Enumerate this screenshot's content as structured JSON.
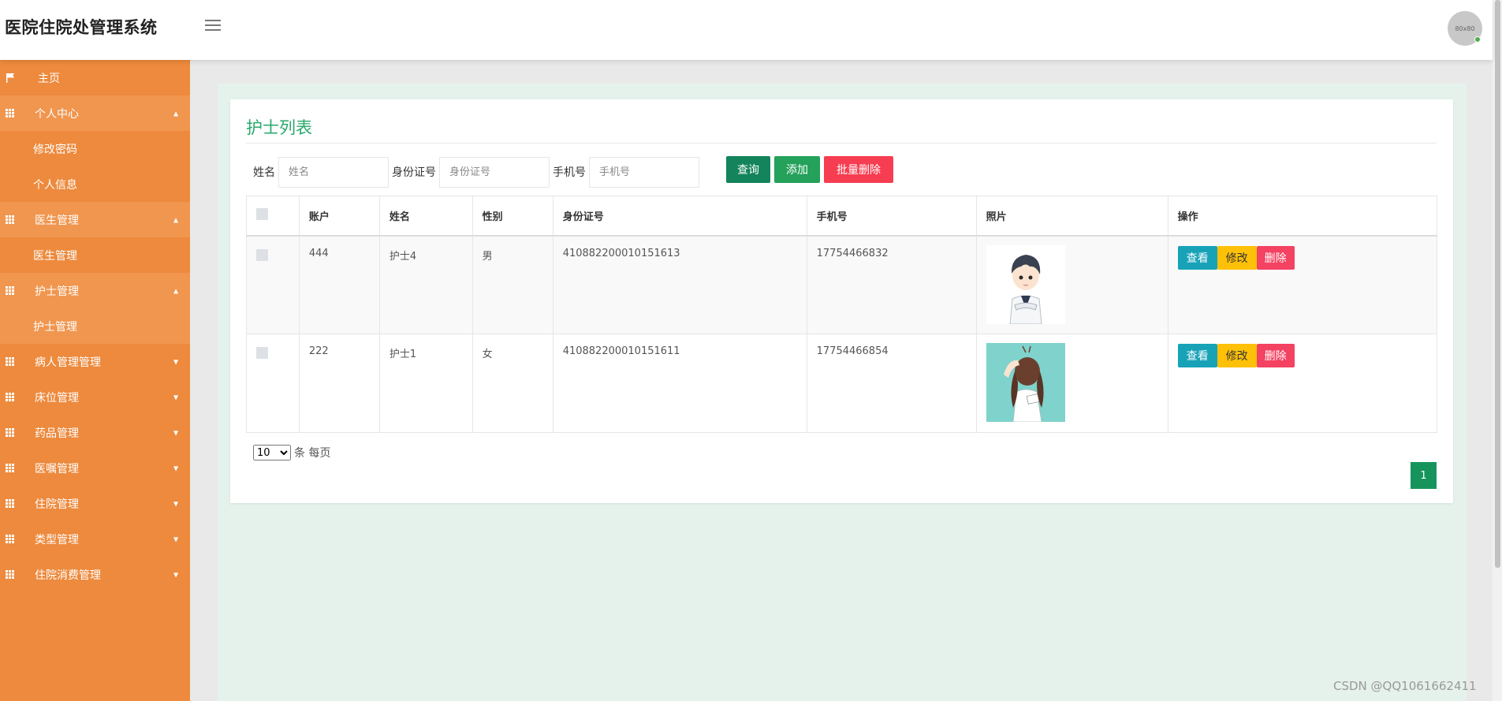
{
  "header": {
    "brand": "医院住院处管理系统",
    "avatar_text": "80x80"
  },
  "sidebar": {
    "home": "主页",
    "groups": [
      {
        "label": "个人中心",
        "expanded": true,
        "children": [
          "修改密码",
          "个人信息"
        ]
      },
      {
        "label": "医生管理",
        "expanded": true,
        "children": [
          "医生管理"
        ]
      },
      {
        "label": "护士管理",
        "expanded": true,
        "children": [
          "护士管理"
        ]
      },
      {
        "label": "病人管理管理",
        "expanded": false,
        "children": []
      },
      {
        "label": "床位管理",
        "expanded": false,
        "children": []
      },
      {
        "label": "药品管理",
        "expanded": false,
        "children": []
      },
      {
        "label": "医嘱管理",
        "expanded": false,
        "children": []
      },
      {
        "label": "住院管理",
        "expanded": false,
        "children": []
      },
      {
        "label": "类型管理",
        "expanded": false,
        "children": []
      },
      {
        "label": "住院消费管理",
        "expanded": false,
        "children": []
      }
    ]
  },
  "main": {
    "title": "护士列表",
    "search": {
      "name_label": "姓名",
      "name_placeholder": "姓名",
      "id_label": "身份证号",
      "id_placeholder": "身份证号",
      "phone_label": "手机号",
      "phone_placeholder": "手机号",
      "query_btn": "查询",
      "add_btn": "添加",
      "batch_delete_btn": "批量删除"
    },
    "table": {
      "headers": [
        "账户",
        "姓名",
        "性别",
        "身份证号",
        "手机号",
        "照片",
        "操作"
      ],
      "rows": [
        {
          "account": "444",
          "name": "护士4",
          "gender": "男",
          "id_number": "410882200010151613",
          "phone": "17754466832",
          "photo": "male-nurse-cartoon"
        },
        {
          "account": "222",
          "name": "护士1",
          "gender": "女",
          "id_number": "410882200010151611",
          "phone": "17754466854",
          "photo": "female-nurse-cartoon"
        }
      ],
      "action_view": "查看",
      "action_edit": "修改",
      "action_delete": "删除"
    },
    "pager": {
      "page_size": "10",
      "page_size_options": [
        "10"
      ],
      "per_page_text": "条 每页",
      "current_page": "1"
    }
  },
  "watermark": "CSDN @QQ1061662411",
  "colors": {
    "sidebar": "#ed8a3d",
    "sidebar_active": "#f0964f",
    "title_green": "#27a86a",
    "query": "#13845b",
    "add": "#24a15a",
    "danger": "#f73d51",
    "info": "#17a2b8",
    "warning": "#ffc107"
  }
}
